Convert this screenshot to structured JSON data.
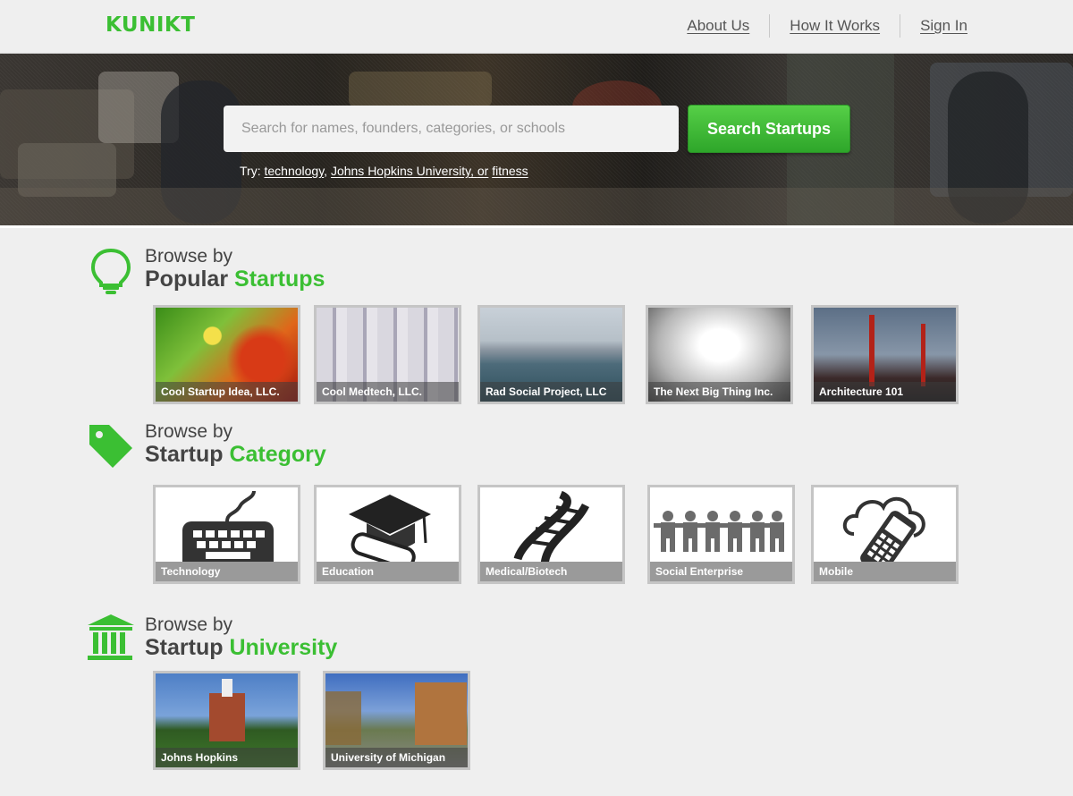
{
  "brand": {
    "logo": "KUNIKT",
    "accent_color": "#3bbf33"
  },
  "nav": {
    "about": "About Us",
    "how": "How It Works",
    "signin": "Sign In"
  },
  "search": {
    "placeholder": "Search for names, founders, categories, or schools",
    "button": "Search Startups",
    "try_prefix": "Try:",
    "suggestions": [
      "technology",
      "Johns Hopkins University",
      "or",
      "fitness"
    ]
  },
  "sections": {
    "popular": {
      "browse_by": "Browse by",
      "title_main": "Popular",
      "title_accent": "Startups",
      "icon": "lightbulb-icon"
    },
    "category": {
      "browse_by": "Browse by",
      "title_main": "Startup",
      "title_accent": "Category",
      "icon": "tag-icon"
    },
    "university": {
      "browse_by": "Browse by",
      "title_main": "Startup",
      "title_accent": "University",
      "icon": "university-building-icon"
    }
  },
  "popular_startups": [
    "Cool Startup Idea, LLC.",
    "Cool Medtech, LLC.",
    "Rad Social Project, LLC",
    "The Next Big Thing Inc.",
    "Architecture 101"
  ],
  "categories": [
    {
      "label": "Technology",
      "icon": "keyboard-icon"
    },
    {
      "label": "Education",
      "icon": "graduation-cap-icon"
    },
    {
      "label": "Medical/Biotech",
      "icon": "dna-icon"
    },
    {
      "label": "Social Enterprise",
      "icon": "paper-people-icon"
    },
    {
      "label": "Mobile",
      "icon": "mobile-phone-icon"
    }
  ],
  "universities": [
    "Johns Hopkins",
    "University of Michigan"
  ]
}
